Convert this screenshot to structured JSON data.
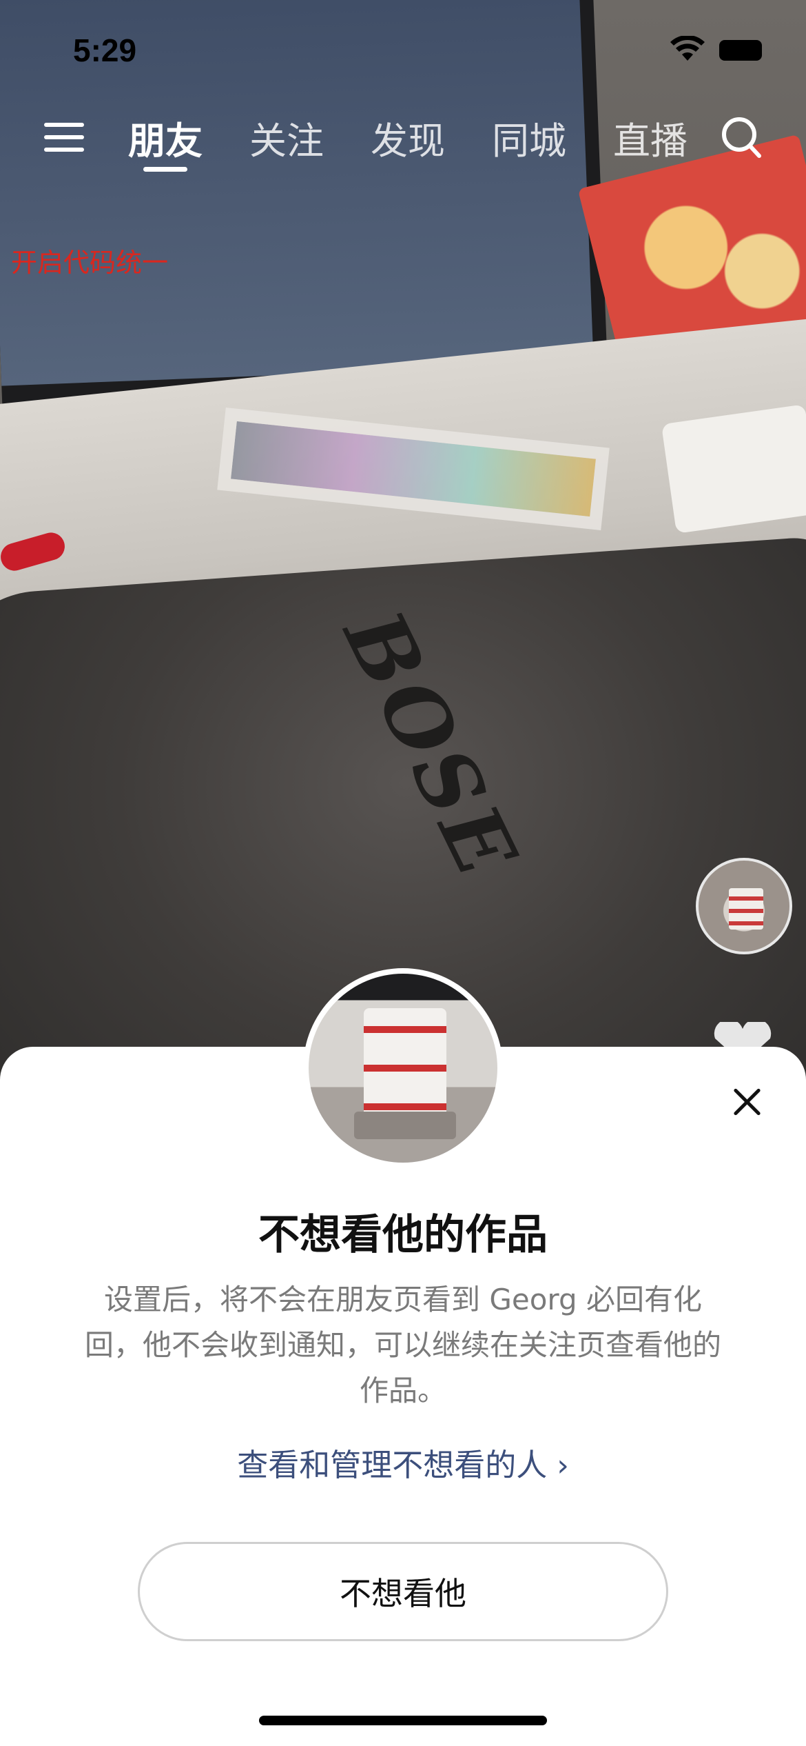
{
  "status_bar": {
    "time": "5:29"
  },
  "nav": {
    "tabs": [
      {
        "label": "朋友",
        "active": true
      },
      {
        "label": "关注",
        "active": false
      },
      {
        "label": "发现",
        "active": false
      },
      {
        "label": "同城",
        "active": false
      },
      {
        "label": "直播",
        "active": false
      }
    ]
  },
  "overlay_label": "开启代码统一",
  "photo_text": "BOSE",
  "sheet": {
    "title": "不想看他的作品",
    "description": "设置后，将不会在朋友页看到 Georg 必回有化回，他不会收到通知，可以继续在关注页查看他的作品。",
    "manage_link": "查看和管理不想看的人",
    "primary_button": "不想看他"
  },
  "colors": {
    "link": "#3c4f7c",
    "red_label": "#d9271f",
    "sheet_bg": "#ffffff"
  }
}
